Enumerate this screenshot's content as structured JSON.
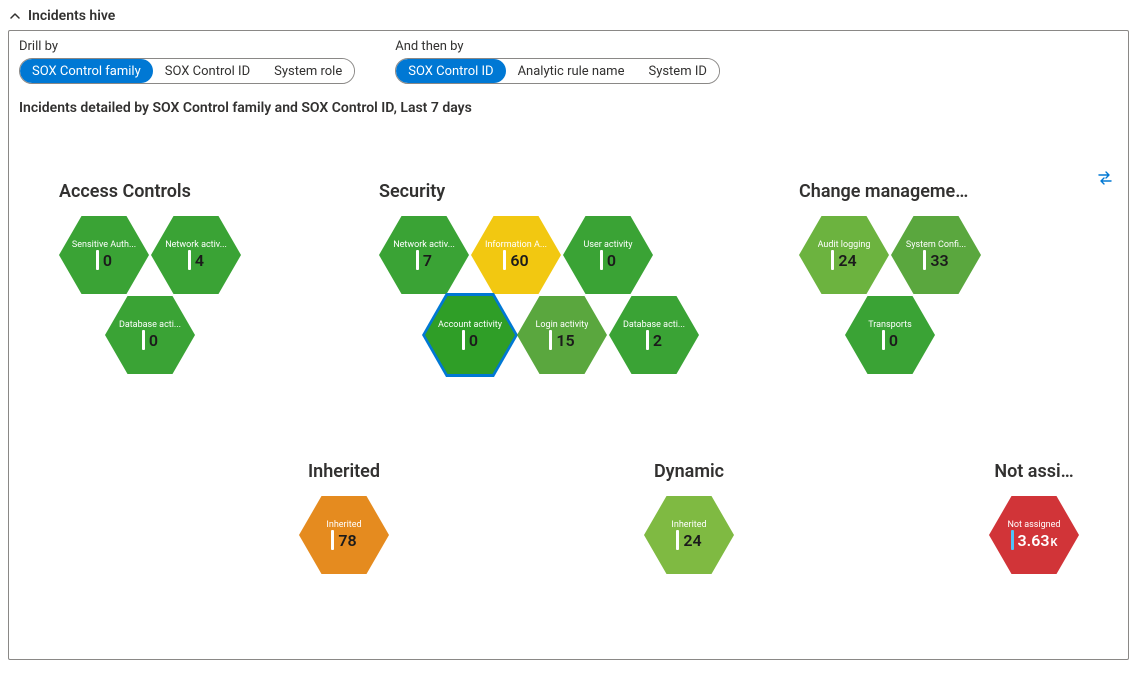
{
  "panel_title": "Incidents hive",
  "drill_by": {
    "label": "Drill by",
    "options": [
      "SOX Control family",
      "SOX Control ID",
      "System role"
    ],
    "active": "SOX Control family"
  },
  "then_by": {
    "label": "And then by",
    "options": [
      "SOX Control ID",
      "Analytic rule name",
      "System ID"
    ],
    "active": "SOX Control ID"
  },
  "subtitle": "Incidents detailed by SOX Control family and SOX Control ID, Last 7 days",
  "groups": {
    "access_controls": {
      "title": "Access Controls",
      "hexes": [
        {
          "label": "Sensitive Auth...",
          "value": "0",
          "color": "c-green-600"
        },
        {
          "label": "Network activ...",
          "value": "4",
          "color": "c-green-600"
        },
        {
          "label": "Database acti...",
          "value": "0",
          "color": "c-green-600"
        }
      ]
    },
    "security": {
      "title": "Security",
      "hexes": [
        {
          "label": "Network activ...",
          "value": "7",
          "color": "c-green-600"
        },
        {
          "label": "Information A...",
          "value": "60",
          "color": "c-yellow"
        },
        {
          "label": "User activity",
          "value": "0",
          "color": "c-green-600"
        },
        {
          "label": "Account activity",
          "value": "0",
          "color": "c-green-700",
          "selected": true
        },
        {
          "label": "Login activity",
          "value": "15",
          "color": "c-green-500"
        },
        {
          "label": "Database acti...",
          "value": "2",
          "color": "c-green-600"
        }
      ]
    },
    "change_mgmt": {
      "title": "Change manageme…",
      "hexes": [
        {
          "label": "Audit logging",
          "value": "24",
          "color": "c-green-450"
        },
        {
          "label": "System Confi...",
          "value": "33",
          "color": "c-green-500"
        },
        {
          "label": "Transports",
          "value": "0",
          "color": "c-green-600"
        }
      ]
    },
    "inherited": {
      "title": "Inherited",
      "hexes": [
        {
          "label": "Inherited",
          "value": "78",
          "color": "c-orange"
        }
      ]
    },
    "dynamic": {
      "title": "Dynamic",
      "hexes": [
        {
          "label": "Inherited",
          "value": "24",
          "color": "c-green-400"
        }
      ]
    },
    "not_assigned": {
      "title": "Not assi…",
      "hexes": [
        {
          "label": "Not assigned",
          "value": "3.63",
          "unit": "K",
          "color": "c-red"
        }
      ]
    }
  }
}
